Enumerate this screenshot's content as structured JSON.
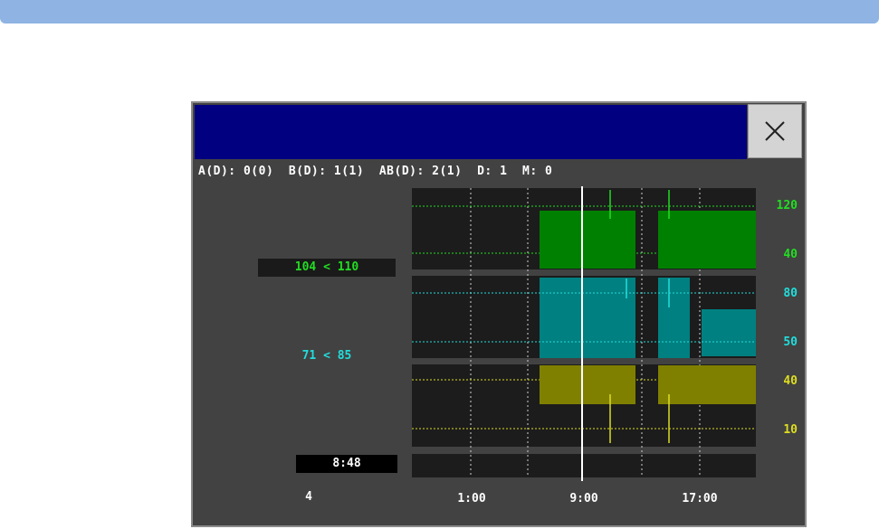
{
  "status_line": "A(D): 0(0)  B(D): 1(1)  AB(D): 2(1)  D: 1  M: 0",
  "readouts": {
    "systolic": "104 < 110",
    "diastolic": "71 < 85",
    "time": "8:48",
    "count": "4"
  },
  "time_axis": [
    "1:00",
    "9:00",
    "17:00"
  ],
  "chart_data": {
    "type": "area",
    "x": [
      "1:00",
      "9:00",
      "17:00"
    ],
    "panels": [
      {
        "name": "",
        "color": "#008000",
        "y_ticks": [
          "120",
          "40"
        ],
        "tick_color": "#22dd22"
      },
      {
        "name": "",
        "color": "#008080",
        "y_ticks": [
          "80",
          "50"
        ],
        "tick_color": "#22dddd"
      },
      {
        "name": "",
        "color": "#808000",
        "y_ticks": [
          "40",
          "10"
        ],
        "tick_color": "#dddd22"
      }
    ],
    "grid": true
  },
  "colors": {
    "green": "#22dd22",
    "cyan": "#22dddd",
    "yellow": "#dddd22"
  },
  "icons": {
    "close": "close-x-icon"
  }
}
